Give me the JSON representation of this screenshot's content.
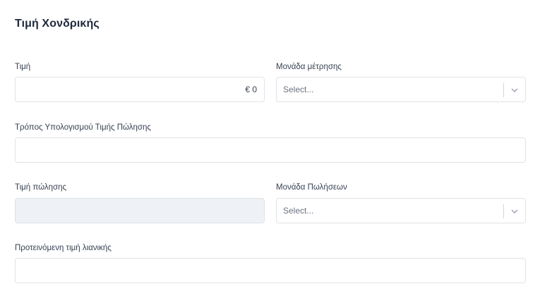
{
  "section": {
    "title": "Τιμή Χονδρικής"
  },
  "fields": {
    "price": {
      "label": "Τιμή",
      "value": "€ 0"
    },
    "unit": {
      "label": "Μονάδα μέτρησης",
      "placeholder": "Select..."
    },
    "calc_method": {
      "label": "Τρόπος Υπολογισμού Τιμής Πώλησης",
      "value": ""
    },
    "sale_price": {
      "label": "Τιμή πώλησης",
      "value": ""
    },
    "sale_unit": {
      "label": "Μονάδα Πωλήσεων",
      "placeholder": "Select..."
    },
    "retail_price": {
      "label": "Προτεινόμενη τιμή λιανικής",
      "value": ""
    }
  },
  "icons": {
    "dropdown": "chevron-down-icon"
  }
}
